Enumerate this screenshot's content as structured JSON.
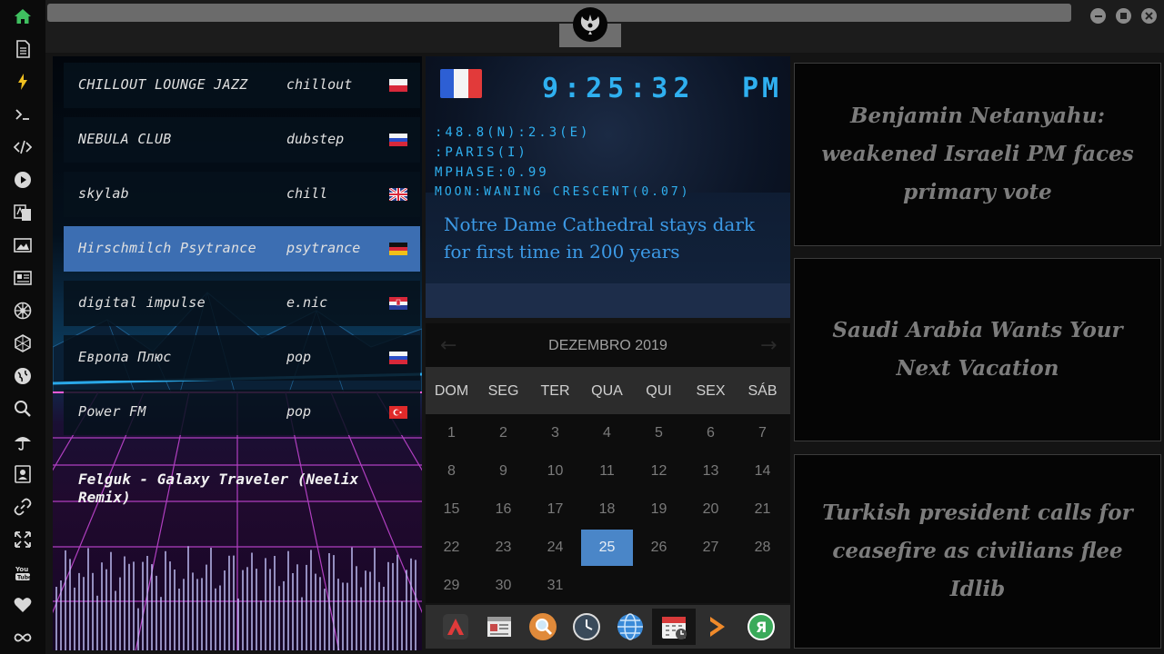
{
  "radio": {
    "stations": [
      {
        "name": "CHILLOUT LOUNGE JAZZ",
        "genre": "chillout",
        "flag": "poland-flag"
      },
      {
        "name": "NEBULA CLUB",
        "genre": "dubstep",
        "flag": "russia-flag"
      },
      {
        "name": "skylab",
        "genre": "chill",
        "flag": "uk-flag"
      },
      {
        "name": "Hirschmilch Psytrance",
        "genre": "psytrance",
        "flag": "germany-flag"
      },
      {
        "name": "digital impulse",
        "genre": "e.nic",
        "flag": "croatia-flag"
      },
      {
        "name": "Европа Плюс",
        "genre": "pop",
        "flag": "russia-flag"
      },
      {
        "name": "Power FM",
        "genre": "pop",
        "flag": "turkey-flag"
      }
    ],
    "active_index": 3,
    "now_playing": "Felguk - Galaxy Traveler (Neelix Remix)"
  },
  "clock": {
    "time": "9:25:32",
    "ampm": "PM",
    "coords": ":48.8(N):2.3(E)",
    "city": ":PARIS(I)",
    "mphase": "MPHASE:0.99",
    "moon": "MOON:WANING CRESCENT(0.07)",
    "headline": "Notre Dame Cathedral stays dark for first time in 200 years",
    "flag": "france-flag"
  },
  "calendar": {
    "month": "DEZEMBRO 2019",
    "prev": "←",
    "next": "→",
    "weekdays": [
      "DOM",
      "SEG",
      "TER",
      "QUA",
      "QUI",
      "SEX",
      "SÁB"
    ],
    "today": 25
  },
  "dock": {
    "items": [
      "launcher-icon",
      "news-reader-icon",
      "search-icon",
      "clock-icon",
      "globe-icon",
      "calendar-icon",
      "play-arrow-icon",
      "yandex-icon"
    ],
    "active_index": 5
  },
  "news": {
    "items": [
      "Benjamin Netanyahu: weakened Israeli PM faces primary vote",
      "Saudi Arabia Wants Your Next Vacation",
      "Turkish president calls for ceasefire as civilians flee Idlib"
    ]
  },
  "colors": {
    "accent": "#4a86c8",
    "clock": "#2fb0f0",
    "sidebar_home": "#3fbf5f"
  }
}
